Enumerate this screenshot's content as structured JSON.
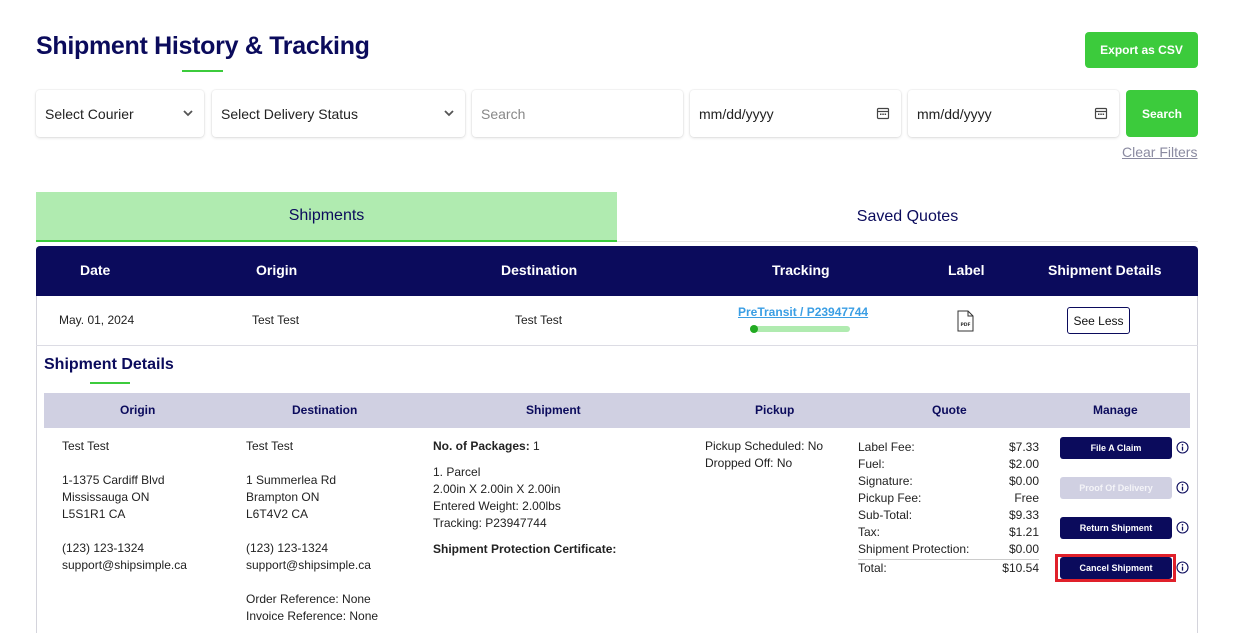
{
  "header": {
    "title": "Shipment History & Tracking",
    "export_label": "Export as CSV"
  },
  "filters": {
    "courier": "Select Courier",
    "status": "Select Delivery Status",
    "search_placeholder": "Search",
    "date_from": "mm/dd/yyyy",
    "date_to": "mm/dd/yyyy",
    "search_label": "Search",
    "clear_label": "Clear Filters"
  },
  "tabs": [
    {
      "label": "Shipments",
      "active": true
    },
    {
      "label": "Saved Quotes",
      "active": false
    }
  ],
  "table": {
    "columns": [
      "Date",
      "Origin",
      "Destination",
      "Tracking",
      "Label",
      "Shipment Details"
    ],
    "row": {
      "date": "May. 01, 2024",
      "origin": "Test Test",
      "destination": "Test Test",
      "tracking": "PreTransit / P23947744",
      "label_icon": "pdf-file-icon",
      "action_label": "See Less"
    }
  },
  "details": {
    "title": "Shipment Details",
    "columns": [
      "Origin",
      "Destination",
      "Shipment",
      "Pickup",
      "Quote",
      "Manage"
    ],
    "origin": [
      "Test Test",
      "",
      "1-1375 Cardiff Blvd",
      "Mississauga ON",
      "L5S1R1 CA",
      "",
      "(123) 123-1324",
      "support@shipsimple.ca"
    ],
    "destination": [
      "Test Test",
      "",
      "1 Summerlea Rd",
      "Brampton ON",
      "L6T4V2 CA",
      "",
      "(123) 123-1324",
      "support@shipsimple.ca",
      "",
      "Order Reference: None",
      "Invoice Reference: None"
    ],
    "shipment": {
      "packages_label": "No. of Packages:",
      "packages_value": "1",
      "lines": [
        "1. Parcel",
        "2.00in X 2.00in X 2.00in",
        "Entered Weight: 2.00lbs",
        "Tracking: P23947744"
      ],
      "protection_label": "Shipment Protection Certificate:"
    },
    "pickup": [
      "Pickup Scheduled: No",
      "Dropped Off: No"
    ],
    "quote": [
      {
        "label": "Label Fee:",
        "value": "$7.33"
      },
      {
        "label": "Fuel:",
        "value": "$2.00"
      },
      {
        "label": "Signature:",
        "value": "$0.00"
      },
      {
        "label": "Pickup Fee:",
        "value": "Free"
      },
      {
        "label": "Sub-Total:",
        "value": "$9.33"
      },
      {
        "label": "Tax:",
        "value": "$1.21"
      },
      {
        "label": "Shipment Protection:",
        "value": "$0.00"
      },
      {
        "label": "Total:",
        "value": "$10.54"
      }
    ],
    "manage": {
      "file_claim": "File A Claim",
      "proof_of_delivery": "Proof Of Delivery",
      "return_shipment": "Return Shipment",
      "cancel_shipment": "Cancel Shipment"
    }
  },
  "colors": {
    "navy": "#0b0b5c",
    "green": "#3ccb3c",
    "light_green": "#b0ebb0",
    "highlight_red": "#e0202a"
  }
}
